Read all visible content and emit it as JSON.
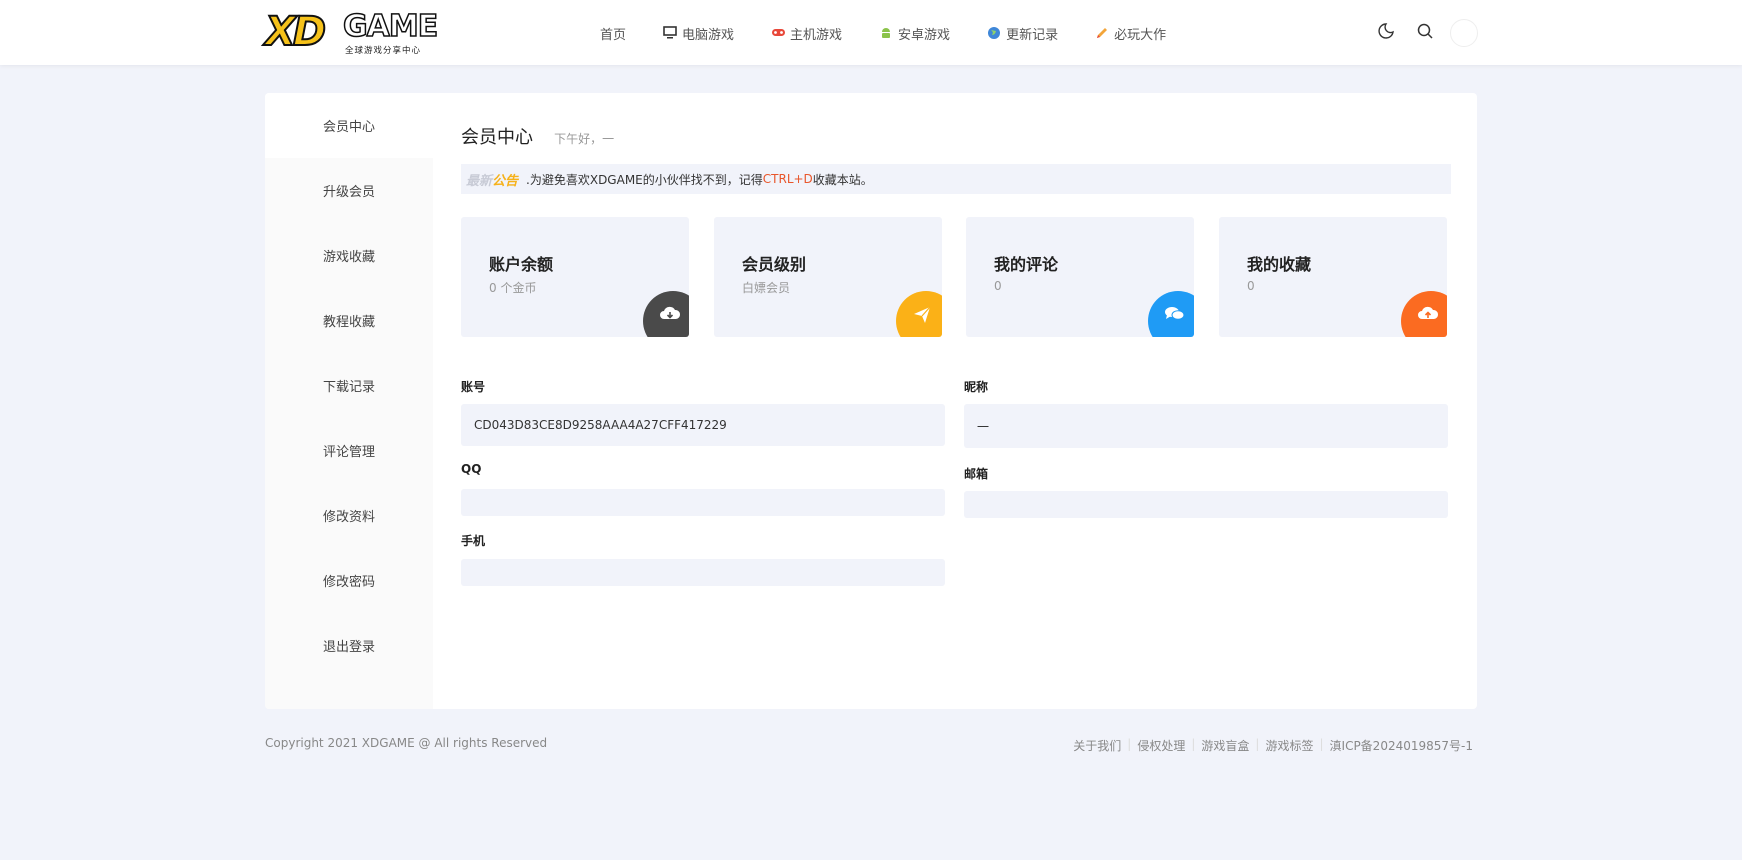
{
  "header": {
    "logo_xd": "XD",
    "logo_game": "GAME",
    "logo_tagline": "全球游戏分享中心",
    "nav": [
      {
        "label": "首页",
        "icon": "none"
      },
      {
        "label": "电脑游戏",
        "icon": "monitor-icon"
      },
      {
        "label": "主机游戏",
        "icon": "gamepad-icon"
      },
      {
        "label": "安卓游戏",
        "icon": "android-icon"
      },
      {
        "label": "更新记录",
        "icon": "globe-icon"
      },
      {
        "label": "必玩大作",
        "icon": "pencil-icon"
      }
    ]
  },
  "sidebar": {
    "items": [
      {
        "label": "会员中心",
        "active": true
      },
      {
        "label": "升级会员"
      },
      {
        "label": "游戏收藏"
      },
      {
        "label": "教程收藏"
      },
      {
        "label": "下载记录"
      },
      {
        "label": "评论管理"
      },
      {
        "label": "修改资料"
      },
      {
        "label": "修改密码"
      },
      {
        "label": "退出登录"
      }
    ]
  },
  "main": {
    "title": "会员中心",
    "greeting": "下午好，一",
    "notice": {
      "tag_a": "最新",
      "tag_b": "公告",
      "text_before": ".为避免喜欢XDGAME的小伙伴找不到，记得",
      "highlight": "CTRL+D",
      "text_after": "收藏本站。"
    },
    "stats": [
      {
        "title": "账户余额",
        "value": "0 个金币",
        "badge_color": "#4a4a4a",
        "icon": "cloud-download-icon"
      },
      {
        "title": "会员级别",
        "value": "白嫖会员",
        "badge_color": "#fbb117",
        "icon": "paper-plane-icon"
      },
      {
        "title": "我的评论",
        "value": "0",
        "badge_color": "#1f9bf5",
        "icon": "comments-icon"
      },
      {
        "title": "我的收藏",
        "value": "0",
        "badge_color": "#fb6b21",
        "icon": "cloud-upload-icon"
      }
    ],
    "form": {
      "account_label": "账号",
      "account_value": "CD043D83CE8D9258AAA4A27CFF417229",
      "nickname_label": "昵称",
      "nickname_value": "一",
      "qq_label": "QQ",
      "qq_value": "",
      "email_label": "邮箱",
      "email_value": "",
      "phone_label": "手机",
      "phone_value": ""
    }
  },
  "footer": {
    "copyright": "Copyright 2021 XDGAME @ All rights Reserved",
    "links": [
      "关于我们",
      "侵权处理",
      "游戏盲盒",
      "游戏标签",
      "滇ICP备2024019857号-1"
    ]
  }
}
